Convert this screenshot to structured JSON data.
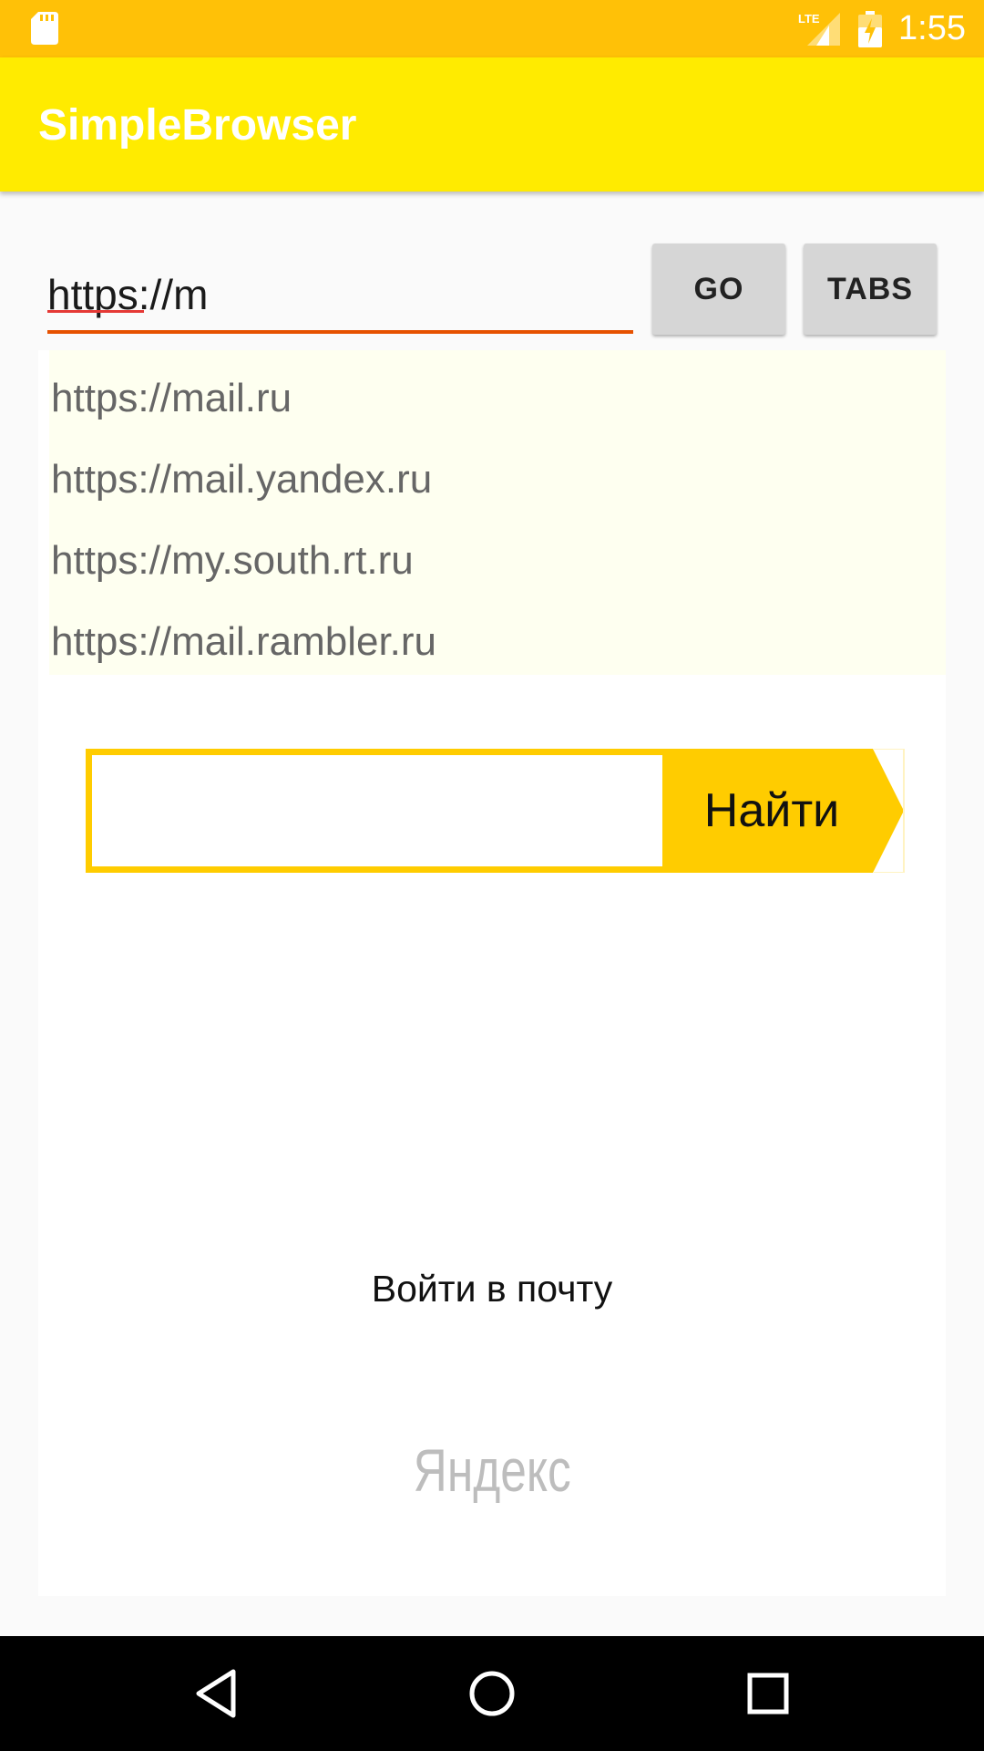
{
  "status_bar": {
    "time": "1:55",
    "network_label": "LTE",
    "icons": [
      "sd-card-icon",
      "lte-signal-icon",
      "battery-charging-icon"
    ]
  },
  "app_bar": {
    "title": "SimpleBrowser"
  },
  "url_bar": {
    "value": "https://m",
    "go_label": "GO",
    "tabs_label": "TABS"
  },
  "suggestions": [
    "https://mail.ru",
    "https://mail.yandex.ru",
    "https://my.south.rt.ru",
    "https://mail.rambler.ru"
  ],
  "web_page": {
    "search_value": "",
    "search_button_label": "Найти",
    "mail_link": "Войти в почту",
    "logo_text": "Яндекс"
  },
  "nav_bar": {
    "icons": [
      "back-icon",
      "home-icon",
      "recents-icon"
    ]
  },
  "colors": {
    "status_bar": "#ffc107",
    "app_bar": "#ffeb00",
    "url_underline": "#e65100",
    "yandex_yellow": "#ffcc00",
    "suggestion_bg": "#fefff0"
  }
}
